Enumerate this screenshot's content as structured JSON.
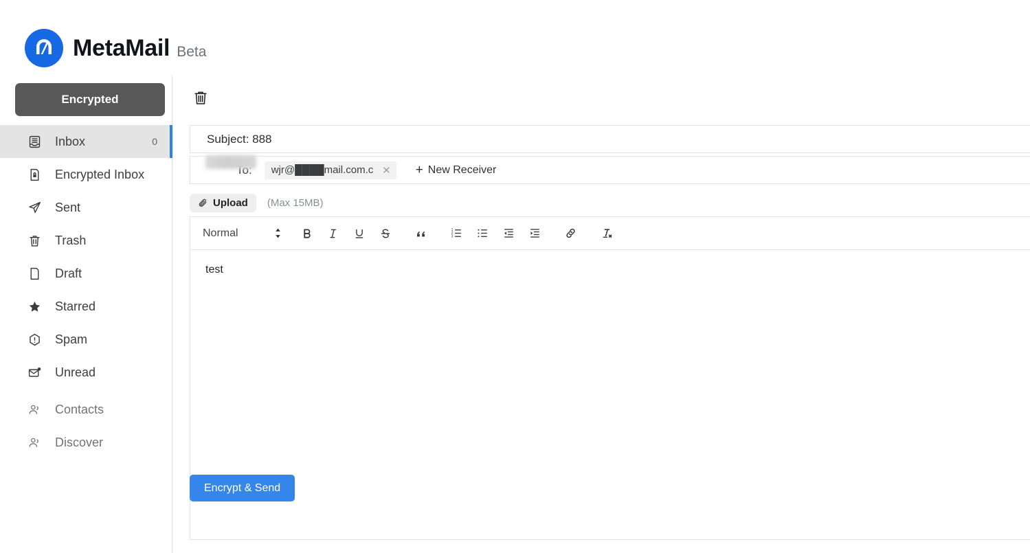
{
  "brand": {
    "logo_icon": "metamail-monogram-icon",
    "title": "MetaMail",
    "beta": "Beta",
    "logo_color": "#1668e3"
  },
  "sidebar": {
    "encrypted_button": "Encrypted",
    "items": [
      {
        "label": "Inbox",
        "icon": "inbox-icon",
        "count": "0",
        "active": true
      },
      {
        "label": "Encrypted Inbox",
        "icon": "lock-document-icon",
        "count": "",
        "active": false
      },
      {
        "label": "Sent",
        "icon": "paper-plane-icon",
        "count": "",
        "active": false
      },
      {
        "label": "Trash",
        "icon": "trash-icon",
        "count": "",
        "active": false
      },
      {
        "label": "Draft",
        "icon": "draft-document-icon",
        "count": "",
        "active": false
      },
      {
        "label": "Starred",
        "icon": "star-icon",
        "count": "",
        "active": false
      },
      {
        "label": "Spam",
        "icon": "spam-alert-icon",
        "count": "",
        "active": false
      },
      {
        "label": "Unread",
        "icon": "unread-envelope-icon",
        "count": "",
        "active": false
      },
      {
        "label": "Contacts",
        "icon": "contacts-icon",
        "count": "",
        "active": false
      },
      {
        "label": "Discover",
        "icon": "discover-people-icon",
        "count": "",
        "active": false
      }
    ]
  },
  "compose": {
    "delete_icon": "trash-icon",
    "subject": "Subject: 888",
    "to_label": "To:",
    "recipient_chip": "wjr@████mail.com.c...",
    "chip_remove_icon": "close-icon",
    "new_receiver": "New Receiver",
    "new_receiver_icon": "plus-icon",
    "upload_label": "Upload",
    "upload_icon": "paperclip-icon",
    "upload_hint": "(Max 15MB)",
    "body_text": "test",
    "send_button": "Encrypt & Send",
    "send_color": "#3585ea"
  },
  "editor_toolbar": {
    "format_name": "Normal",
    "format_arrows_icon": "updown-arrows-icon",
    "buttons": [
      {
        "name": "bold-button",
        "icon": "bold-icon",
        "glyph": "B"
      },
      {
        "name": "italic-button",
        "icon": "italic-icon",
        "glyph": "I"
      },
      {
        "name": "underline-button",
        "icon": "underline-icon",
        "glyph": "U"
      },
      {
        "name": "strike-button",
        "icon": "strikethrough-icon",
        "glyph": "S"
      },
      {
        "name": "blockquote-button",
        "icon": "blockquote-icon",
        "glyph": "”"
      },
      {
        "name": "ordered-list-button",
        "icon": "ordered-list-icon",
        "glyph": ""
      },
      {
        "name": "bullet-list-button",
        "icon": "bullet-list-icon",
        "glyph": ""
      },
      {
        "name": "outdent-button",
        "icon": "outdent-icon",
        "glyph": ""
      },
      {
        "name": "indent-button",
        "icon": "indent-icon",
        "glyph": ""
      },
      {
        "name": "link-button",
        "icon": "link-icon",
        "glyph": ""
      },
      {
        "name": "clear-format-button",
        "icon": "clear-formatting-icon",
        "glyph": ""
      }
    ]
  }
}
